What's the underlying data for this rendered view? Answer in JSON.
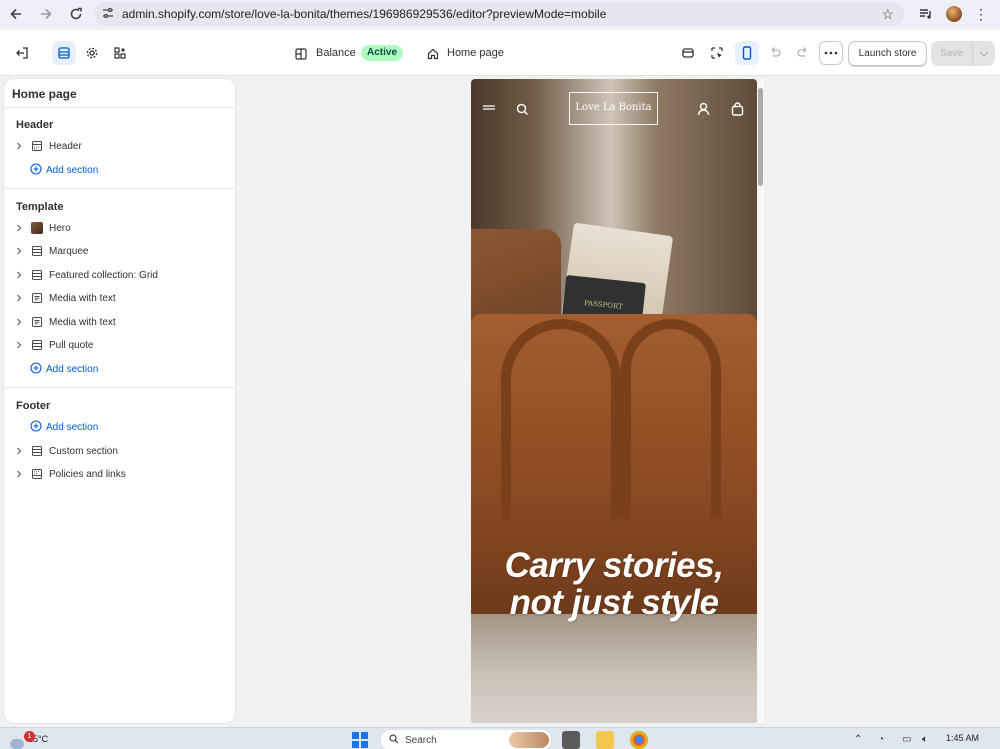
{
  "browser": {
    "url": "admin.shopify.com/store/love-la-bonita/themes/196986929536/editor?previewMode=mobile"
  },
  "editor": {
    "theme_name": "Balance",
    "theme_status": "Active",
    "page_name": "Home page",
    "launch_label": "Launch store",
    "save_label": "Save"
  },
  "sidebar": {
    "title": "Home page",
    "groups": {
      "header": {
        "label": "Header",
        "items": [
          {
            "label": "Header",
            "icon": "section-icon"
          }
        ],
        "add_label": "Add section"
      },
      "template": {
        "label": "Template",
        "items": [
          {
            "label": "Hero",
            "icon": "image-thumbnail"
          },
          {
            "label": "Marquee",
            "icon": "section-icon"
          },
          {
            "label": "Featured collection: Grid",
            "icon": "section-icon"
          },
          {
            "label": "Media with text",
            "icon": "media-text-icon"
          },
          {
            "label": "Media with text",
            "icon": "media-text-icon"
          },
          {
            "label": "Pull quote",
            "icon": "section-icon"
          }
        ],
        "add_label": "Add section"
      },
      "footer": {
        "label": "Footer",
        "add_label": "Add section",
        "items": [
          {
            "label": "Custom section",
            "icon": "section-icon"
          },
          {
            "label": "Policies and links",
            "icon": "footer-section-icon"
          }
        ]
      }
    }
  },
  "preview": {
    "logo": "Love La Bonita",
    "headline_line1": "Carry stories,",
    "headline_line2": "not just style",
    "passport_text": "PASSPORT"
  },
  "taskbar": {
    "temperature": "25°C",
    "notification_count": "1",
    "search_placeholder": "Search",
    "time": "1:45 AM"
  }
}
